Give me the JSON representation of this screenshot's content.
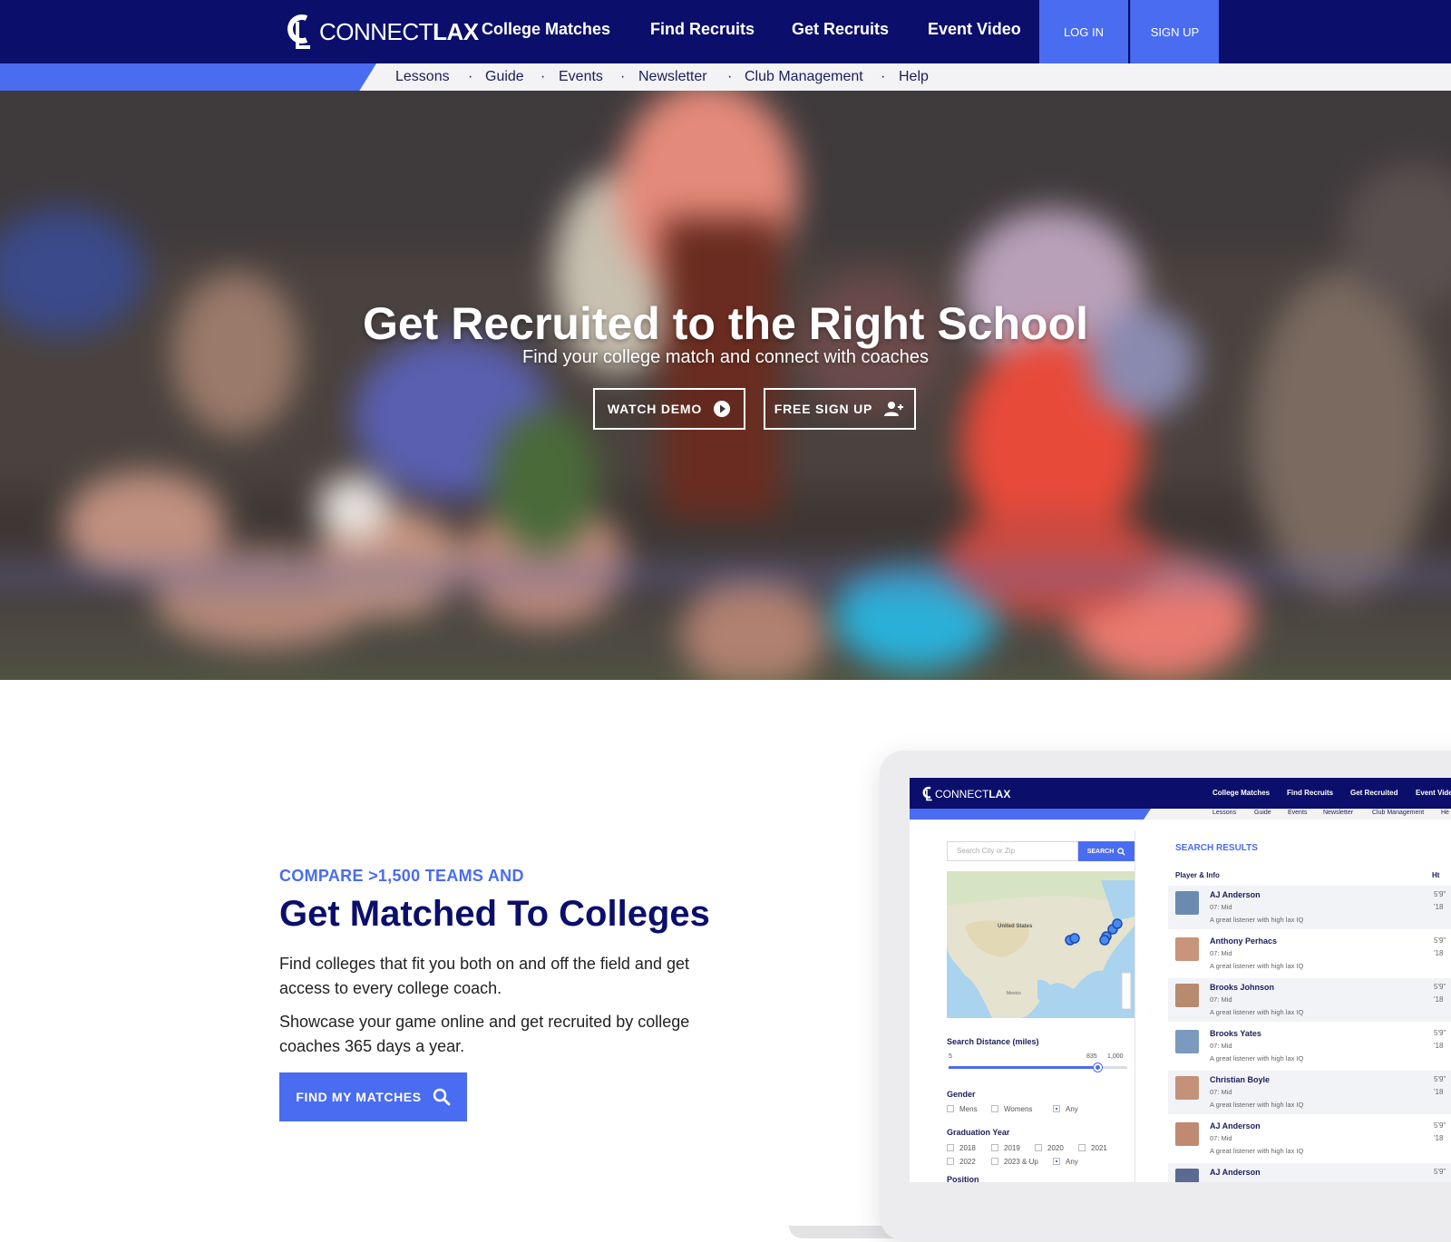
{
  "brand": {
    "logo_prefix": "CONNECT",
    "logo_suffix": "LAX"
  },
  "topnav": {
    "links": [
      "College Matches",
      "Find Recruits",
      "Get Recruits",
      "Event Video"
    ],
    "login": "LOG IN",
    "signup": "SIGN UP"
  },
  "subnav": {
    "links": [
      "Lessons",
      "Guide",
      "Events",
      "Newsletter",
      "Club Management",
      "Help"
    ],
    "separator": "·"
  },
  "hero": {
    "title": "Get Recruited to the Right School",
    "subtitle": "Find your college match and connect with coaches",
    "watch_demo": "WATCH DEMO",
    "free_signup": "FREE SIGN UP"
  },
  "feature": {
    "eyebrow": "COMPARE >1,500 TEAMS AND",
    "title": "Get Matched To Colleges",
    "para1": "Find colleges that fit you both on and off the field and get access to every college coach.",
    "para2": "Showcase your game online and get recruited by college coaches 365 days a year.",
    "cta": "FIND MY MATCHES"
  },
  "mockup": {
    "logo_prefix": "CONNECT",
    "logo_suffix": "LAX",
    "nav": [
      "College Matches",
      "Find Recruits",
      "Get Recruited",
      "Event Vide"
    ],
    "subnav": [
      "Lessons",
      "Guide",
      "Events",
      "Newsletter",
      "Club Management",
      "He"
    ],
    "search_placeholder": "Search City or Zip",
    "search_button": "SEARCH",
    "map_labels": {
      "country": "United States",
      "mexico": "Mexico"
    },
    "distance_label": "Search Distance (miles)",
    "distance_min": "5",
    "distance_value": "835",
    "distance_max": "1,000",
    "distance_fraction": 0.835,
    "gender_label": "Gender",
    "gender_options": [
      {
        "label": "Mens",
        "checked": false
      },
      {
        "label": "Womens",
        "checked": false
      },
      {
        "label": "Any",
        "checked": true
      }
    ],
    "grad_label": "Graduation Year",
    "grad_options_row1": [
      {
        "label": "2018",
        "checked": false
      },
      {
        "label": "2019",
        "checked": false
      },
      {
        "label": "2020",
        "checked": false
      },
      {
        "label": "2021",
        "checked": false
      }
    ],
    "grad_options_row2": [
      {
        "label": "2022",
        "checked": false
      },
      {
        "label": "2023 & Up",
        "checked": false
      },
      {
        "label": "Any",
        "checked": true
      }
    ],
    "position_label": "Position",
    "results_title": "SEARCH RESULTS",
    "col_player": "Player & Info",
    "col_ht": "Ht",
    "players": [
      {
        "name": "AJ Anderson",
        "pos": "07: Mid",
        "desc": "A great listener with high lax IQ",
        "ht": "5'9\"",
        "yr": "'18"
      },
      {
        "name": "Anthony Perhacs",
        "pos": "07: Mid",
        "desc": "A great listener with high lax IQ",
        "ht": "5'9\"",
        "yr": "'18"
      },
      {
        "name": "Brooks Johnson",
        "pos": "07: Mid",
        "desc": "A great listener with high lax IQ",
        "ht": "5'9\"",
        "yr": "'18"
      },
      {
        "name": "Brooks Yates",
        "pos": "07: Mid",
        "desc": "A great listener with high lax IQ",
        "ht": "5'9\"",
        "yr": "'18"
      },
      {
        "name": "Christian Boyle",
        "pos": "07: Mid",
        "desc": "A great listener with high lax IQ",
        "ht": "5'9\"",
        "yr": "'18"
      },
      {
        "name": "AJ Anderson",
        "pos": "07: Mid",
        "desc": "A great listener with high lax IQ",
        "ht": "5'9\"",
        "yr": "'18"
      },
      {
        "name": "AJ Anderson",
        "pos": "",
        "desc": "",
        "ht": "5'9\"",
        "yr": ""
      }
    ]
  },
  "colors": {
    "navy": "#0b0f6b",
    "accent": "#4a6cf0",
    "text": "#222222"
  }
}
